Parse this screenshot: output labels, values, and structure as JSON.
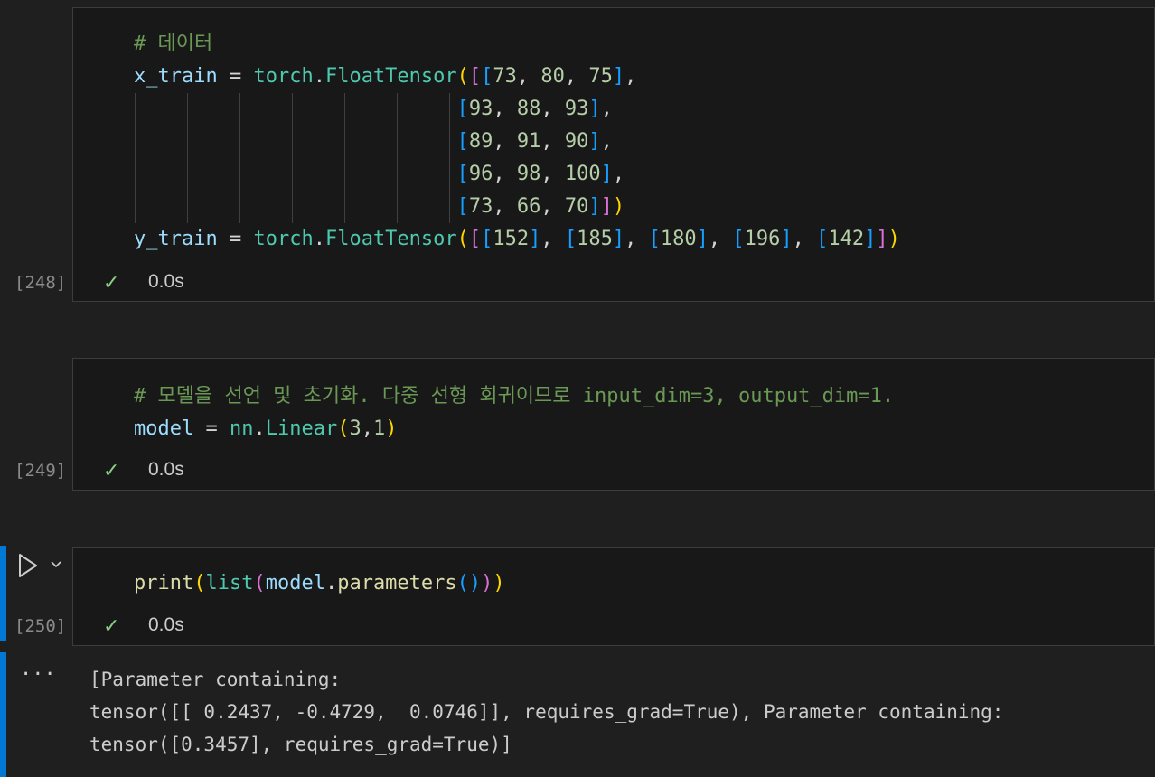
{
  "cells": [
    {
      "execution_count": "[248]",
      "duration": "0.0s",
      "code_lines": [
        {
          "tokens": [
            {
              "t": "# 데이터",
              "c": "c-cm"
            }
          ]
        },
        {
          "tokens": [
            {
              "t": "x_train",
              "c": "c-var"
            },
            {
              "t": " = ",
              "c": "c-op"
            },
            {
              "t": "torch",
              "c": "c-fn"
            },
            {
              "t": ".",
              "c": "c-op"
            },
            {
              "t": "FloatTensor",
              "c": "c-fn"
            },
            {
              "t": "(",
              "c": "c-p1"
            },
            {
              "t": "[",
              "c": "c-p2"
            },
            {
              "t": "[",
              "c": "c-p3"
            },
            {
              "t": "73",
              "c": "c-num"
            },
            {
              "t": ", ",
              "c": "c-op"
            },
            {
              "t": "80",
              "c": "c-num"
            },
            {
              "t": ", ",
              "c": "c-op"
            },
            {
              "t": "75",
              "c": "c-num"
            },
            {
              "t": "]",
              "c": "c-p3"
            },
            {
              "t": ",",
              "c": "c-op"
            }
          ]
        },
        {
          "tokens": [
            {
              "t": "                           ",
              "c": "c-op"
            },
            {
              "t": "[",
              "c": "c-p3"
            },
            {
              "t": "93",
              "c": "c-num"
            },
            {
              "t": ", ",
              "c": "c-op"
            },
            {
              "t": "88",
              "c": "c-num"
            },
            {
              "t": ", ",
              "c": "c-op"
            },
            {
              "t": "93",
              "c": "c-num"
            },
            {
              "t": "]",
              "c": "c-p3"
            },
            {
              "t": ",",
              "c": "c-op"
            }
          ]
        },
        {
          "tokens": [
            {
              "t": "                           ",
              "c": "c-op"
            },
            {
              "t": "[",
              "c": "c-p3"
            },
            {
              "t": "89",
              "c": "c-num"
            },
            {
              "t": ", ",
              "c": "c-op"
            },
            {
              "t": "91",
              "c": "c-num"
            },
            {
              "t": ", ",
              "c": "c-op"
            },
            {
              "t": "90",
              "c": "c-num"
            },
            {
              "t": "]",
              "c": "c-p3"
            },
            {
              "t": ",",
              "c": "c-op"
            }
          ]
        },
        {
          "tokens": [
            {
              "t": "                           ",
              "c": "c-op"
            },
            {
              "t": "[",
              "c": "c-p3"
            },
            {
              "t": "96",
              "c": "c-num"
            },
            {
              "t": ", ",
              "c": "c-op"
            },
            {
              "t": "98",
              "c": "c-num"
            },
            {
              "t": ", ",
              "c": "c-op"
            },
            {
              "t": "100",
              "c": "c-num"
            },
            {
              "t": "]",
              "c": "c-p3"
            },
            {
              "t": ",",
              "c": "c-op"
            }
          ]
        },
        {
          "tokens": [
            {
              "t": "                           ",
              "c": "c-op"
            },
            {
              "t": "[",
              "c": "c-p3"
            },
            {
              "t": "73",
              "c": "c-num"
            },
            {
              "t": ", ",
              "c": "c-op"
            },
            {
              "t": "66",
              "c": "c-num"
            },
            {
              "t": ", ",
              "c": "c-op"
            },
            {
              "t": "70",
              "c": "c-num"
            },
            {
              "t": "]",
              "c": "c-p3"
            },
            {
              "t": "]",
              "c": "c-p2"
            },
            {
              "t": ")",
              "c": "c-p1"
            }
          ]
        },
        {
          "tokens": [
            {
              "t": "y_train",
              "c": "c-var"
            },
            {
              "t": " = ",
              "c": "c-op"
            },
            {
              "t": "torch",
              "c": "c-fn"
            },
            {
              "t": ".",
              "c": "c-op"
            },
            {
              "t": "FloatTensor",
              "c": "c-fn"
            },
            {
              "t": "(",
              "c": "c-p1"
            },
            {
              "t": "[",
              "c": "c-p2"
            },
            {
              "t": "[",
              "c": "c-p3"
            },
            {
              "t": "152",
              "c": "c-num"
            },
            {
              "t": "]",
              "c": "c-p3"
            },
            {
              "t": ", ",
              "c": "c-op"
            },
            {
              "t": "[",
              "c": "c-p3"
            },
            {
              "t": "185",
              "c": "c-num"
            },
            {
              "t": "]",
              "c": "c-p3"
            },
            {
              "t": ", ",
              "c": "c-op"
            },
            {
              "t": "[",
              "c": "c-p3"
            },
            {
              "t": "180",
              "c": "c-num"
            },
            {
              "t": "]",
              "c": "c-p3"
            },
            {
              "t": ", ",
              "c": "c-op"
            },
            {
              "t": "[",
              "c": "c-p3"
            },
            {
              "t": "196",
              "c": "c-num"
            },
            {
              "t": "]",
              "c": "c-p3"
            },
            {
              "t": ", ",
              "c": "c-op"
            },
            {
              "t": "[",
              "c": "c-p3"
            },
            {
              "t": "142",
              "c": "c-num"
            },
            {
              "t": "]",
              "c": "c-p3"
            },
            {
              "t": "]",
              "c": "c-p2"
            },
            {
              "t": ")",
              "c": "c-p1"
            }
          ]
        }
      ]
    },
    {
      "execution_count": "[249]",
      "duration": "0.0s",
      "code_lines": [
        {
          "tokens": [
            {
              "t": "# 모델을 선언 및 초기화. 다중 선형 회귀이므로 input_dim=3, output_dim=1.",
              "c": "c-cm"
            }
          ]
        },
        {
          "tokens": [
            {
              "t": "model",
              "c": "c-var"
            },
            {
              "t": " = ",
              "c": "c-op"
            },
            {
              "t": "nn",
              "c": "c-fn"
            },
            {
              "t": ".",
              "c": "c-op"
            },
            {
              "t": "Linear",
              "c": "c-fn"
            },
            {
              "t": "(",
              "c": "c-p1"
            },
            {
              "t": "3",
              "c": "c-num"
            },
            {
              "t": ",",
              "c": "c-op"
            },
            {
              "t": "1",
              "c": "c-num"
            },
            {
              "t": ")",
              "c": "c-p1"
            }
          ]
        }
      ]
    },
    {
      "execution_count": "[250]",
      "duration": "0.0s",
      "code_lines": [
        {
          "tokens": [
            {
              "t": "print",
              "c": "c-call"
            },
            {
              "t": "(",
              "c": "c-p1"
            },
            {
              "t": "list",
              "c": "c-fn"
            },
            {
              "t": "(",
              "c": "c-p2"
            },
            {
              "t": "model",
              "c": "c-var"
            },
            {
              "t": ".",
              "c": "c-op"
            },
            {
              "t": "parameters",
              "c": "c-call"
            },
            {
              "t": "(",
              "c": "c-p3"
            },
            {
              "t": ")",
              "c": "c-p3"
            },
            {
              "t": ")",
              "c": "c-p2"
            },
            {
              "t": ")",
              "c": "c-p1"
            }
          ]
        }
      ]
    }
  ],
  "output_lines": [
    "[Parameter containing:",
    "tensor([[ 0.2437, -0.4729,  0.0746]], requires_grad=True), Parameter containing:",
    "tensor([0.3457], requires_grad=True)]"
  ],
  "icons": {
    "check": "✓",
    "ellipsis": "···",
    "chevron": "⌄"
  },
  "colors": {
    "accent": "#0078d4",
    "success": "#89d185"
  }
}
